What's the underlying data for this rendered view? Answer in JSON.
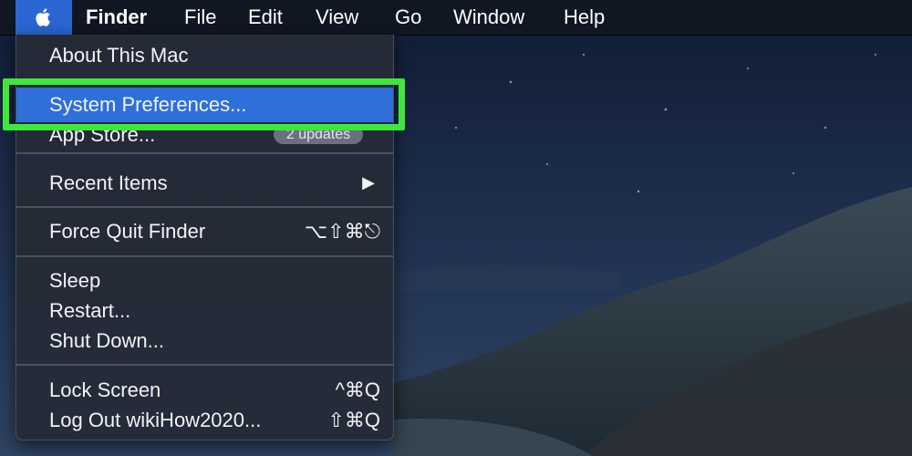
{
  "menubar": {
    "apple_icon": "apple-icon",
    "items": [
      "Finder",
      "File",
      "Edit",
      "View",
      "Go",
      "Window",
      "Help"
    ]
  },
  "apple_menu": {
    "about": "About This Mac",
    "system_preferences": "System Preferences...",
    "app_store": "App Store...",
    "app_store_badge": "2 updates",
    "recent_items": "Recent Items",
    "recent_items_arrow": "▶",
    "force_quit": "Force Quit Finder",
    "force_quit_shortcut": "⌥⇧⌘⎋",
    "sleep": "Sleep",
    "restart": "Restart...",
    "shut_down": "Shut Down...",
    "lock_screen": "Lock Screen",
    "lock_screen_shortcut": "^⌘Q",
    "log_out": "Log Out wikiHow2020...",
    "log_out_shortcut": "⇧⌘Q"
  },
  "colors": {
    "highlight_annotation": "#3ee83a",
    "selection": "#2e6fd9",
    "menu_background": "#252a37"
  }
}
